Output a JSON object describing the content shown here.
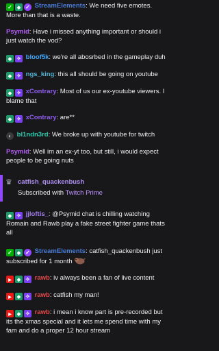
{
  "messages": [
    {
      "user": "StreamElements",
      "text": ": We need five emotes. More than that is a waste."
    },
    {
      "user": "Psymid",
      "text": ": Have i missed anything important or should i just watch the vod?"
    },
    {
      "user": "bloof5k",
      "text": ": we're all abosrbed in the gameplay duh"
    },
    {
      "user": "ngs_king",
      "text": ": this all should be going on youtube"
    },
    {
      "user": "xContrary",
      "text": ": Most of us our ex-youtube viewers. I blame that"
    },
    {
      "user": "xContrary",
      "text": ": are**"
    },
    {
      "user": "bl1ndn3rd",
      "text": ": We broke up with youtube for twitch"
    },
    {
      "user": "Psymid",
      "text": ": Well im an ex-yt too, but still, i would expect people to be going nuts"
    },
    {
      "user": "jjloftis_",
      "text": ": @Psymid chat is chilling watching Romain and Rawb play a fake street fighter game thats all"
    },
    {
      "user": "StreamElements",
      "text": ": catfish_quackenbush just subscribed for 1 month"
    },
    {
      "user": "rawb",
      "text": ": iv always been a fan of live content"
    },
    {
      "user": "rawb",
      "text": ": catfish my man!"
    },
    {
      "user": "rawb",
      "text": ": i mean i know part is pre-recorded but its the xmas special and it lets me spend time with my fam and do a proper 12 hour stream"
    }
  ],
  "sub_notice": {
    "user": "catfish_quackenbush",
    "text_prefix": "Subscribed with ",
    "text_prime": "Twitch Prime"
  },
  "colors": {
    "background": "#18181b",
    "streamelements": "#4a7dd6",
    "psymid": "#b05df0",
    "rawb": "#e44b4b",
    "sub_border": "#9147ff"
  },
  "icons": [
    "moderator-badge-icon",
    "vip-badge-icon",
    "subscriber-badge-icon",
    "verified-badge-icon",
    "broadcaster-badge-icon",
    "crown-icon",
    "emote-icon"
  ]
}
